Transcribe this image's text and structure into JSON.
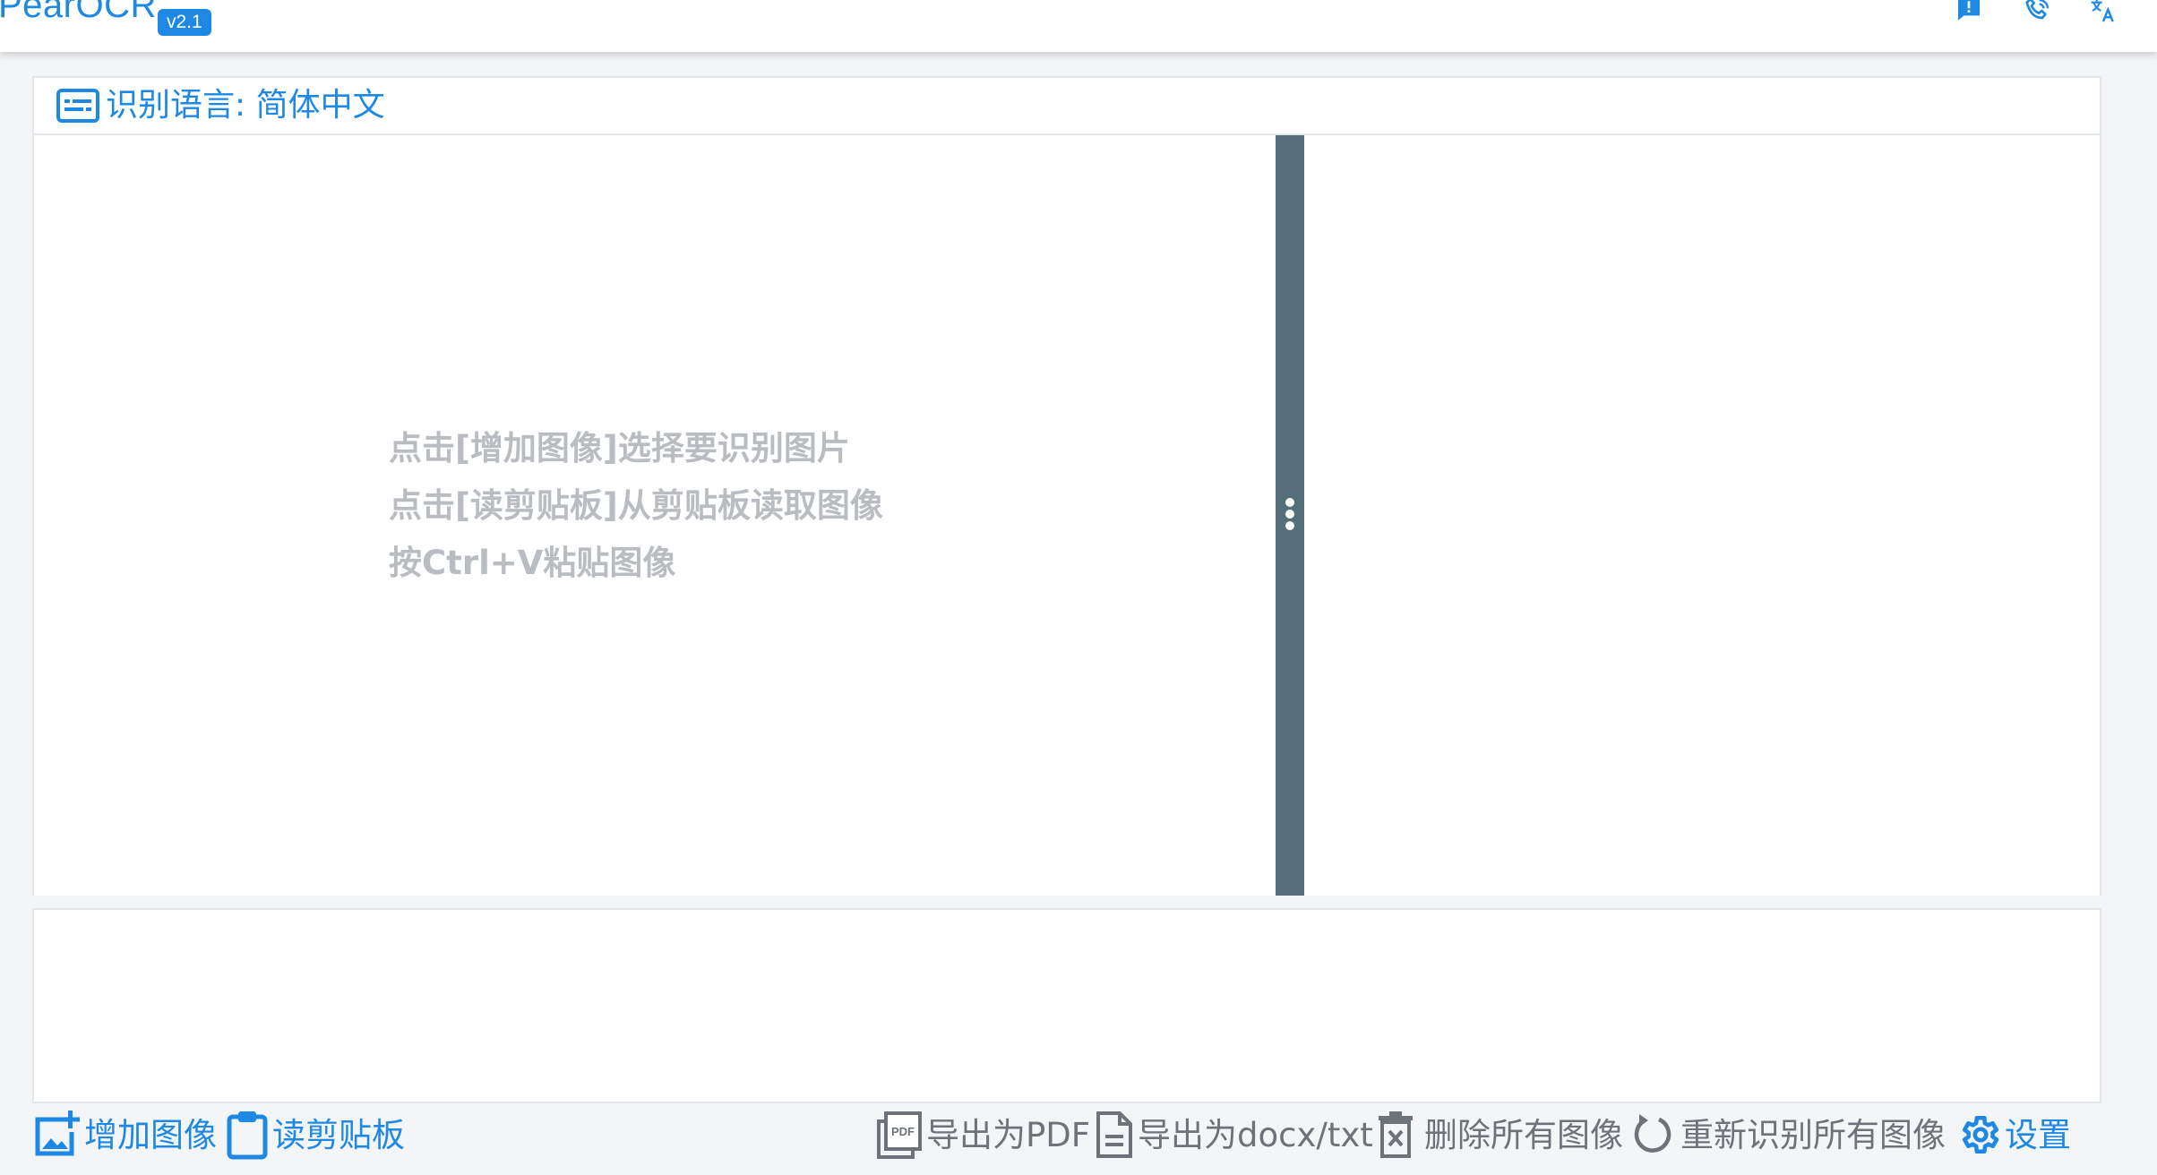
{
  "app": {
    "title": "PearOCR",
    "version": "v2.1",
    "accent_color": "#1e88e5",
    "header_icons": [
      "feedback-icon",
      "phone-icon",
      "translate-icon"
    ]
  },
  "language_selector": {
    "label": "识别语言: 简体中文",
    "icon": "subtitles-icon"
  },
  "image_pane": {
    "hints": [
      "点击[增加图像]选择要识别图片",
      "点击[读剪贴板]从剪贴板读取图像",
      "按Ctrl+V粘贴图像"
    ]
  },
  "result_text": "",
  "toolbar": {
    "add_image": {
      "label": "增加图像",
      "icon": "add-image-icon"
    },
    "read_clipboard": {
      "label": "读剪贴板",
      "icon": "clipboard-icon"
    },
    "export_pdf": {
      "label": "导出为PDF",
      "icon": "pdf-file-icon"
    },
    "export_docx": {
      "label": "导出为docx/txt",
      "icon": "document-icon"
    },
    "delete_all": {
      "label": "删除所有图像",
      "icon": "delete-icon"
    },
    "rerecognize_all": {
      "label": "重新识别所有图像",
      "icon": "refresh-icon"
    },
    "settings": {
      "label": "设置",
      "icon": "gear-icon"
    }
  }
}
